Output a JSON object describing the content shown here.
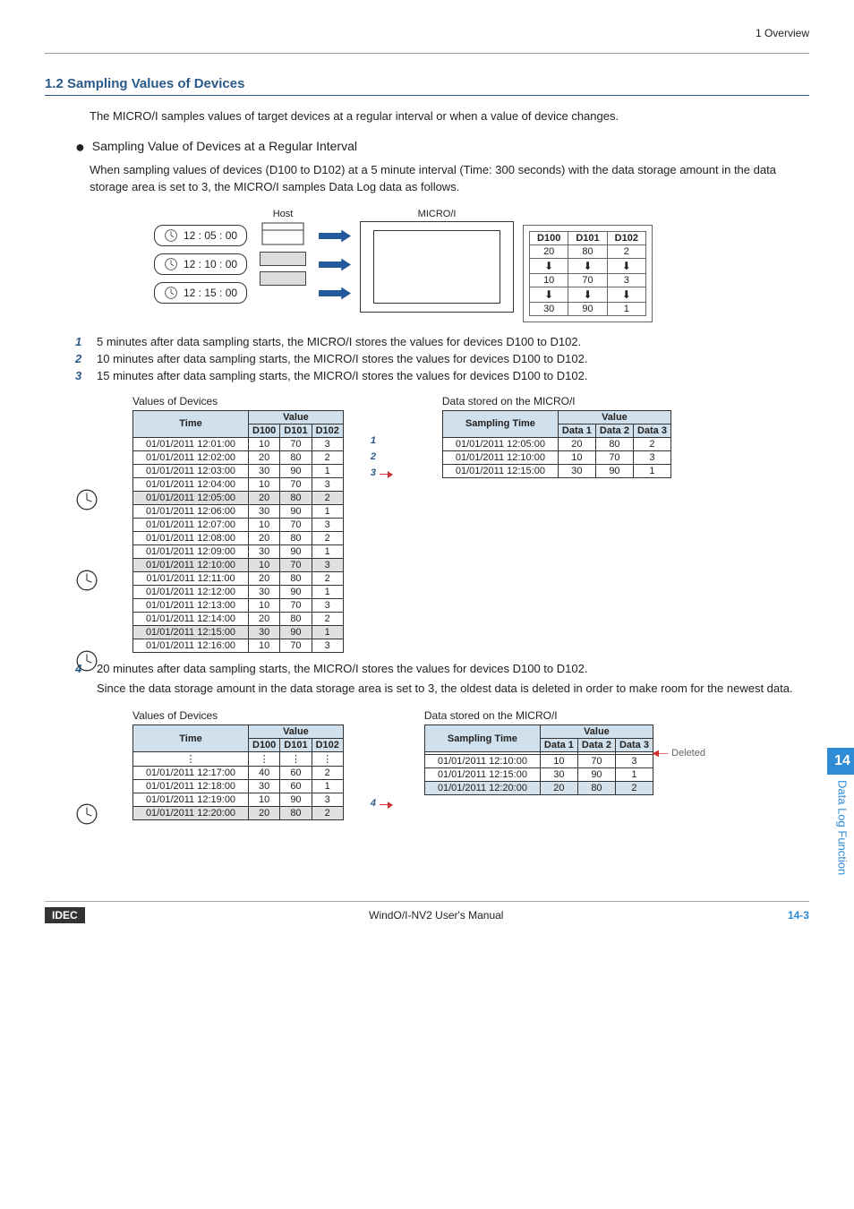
{
  "header": {
    "section": "1 Overview"
  },
  "title": "1.2  Sampling Values of Devices",
  "intro": "The MICRO/I samples values of target devices at a regular interval or when a value of device changes.",
  "sub1": {
    "heading": "Sampling Value of Devices at a Regular Interval",
    "text": "When sampling values of devices (D100 to D102) at a 5 minute interval (Time: 300 seconds) with the data storage amount in the data storage area is set to 3, the MICRO/I samples Data Log data as follows."
  },
  "diagram": {
    "host_label": "Host",
    "microi_label": "MICRO/I",
    "times": [
      "12 : 05 : 00",
      "12 : 10 : 00",
      "12 : 15 : 00"
    ],
    "d_headers": [
      "D100",
      "D101",
      "D102"
    ],
    "d_rows": [
      [
        "20",
        "80",
        "2"
      ],
      [
        "10",
        "70",
        "3"
      ],
      [
        "30",
        "90",
        "1"
      ]
    ]
  },
  "steps123": [
    "5 minutes after data sampling starts, the MICRO/I stores the values for devices D100 to D102.",
    "10 minutes after data sampling starts, the MICRO/I stores the values for devices D100 to D102.",
    "15 minutes after data sampling starts, the MICRO/I stores the values for devices D100 to D102."
  ],
  "table1": {
    "left_caption": "Values of Devices",
    "right_caption": "Data stored on the MICRO/I",
    "left_headers": {
      "time": "Time",
      "value": "Value",
      "cols": [
        "D100",
        "D101",
        "D102"
      ]
    },
    "right_headers": {
      "time": "Sampling Time",
      "value": "Value",
      "cols": [
        "Data 1",
        "Data 2",
        "Data 3"
      ]
    },
    "left_rows": [
      {
        "t": "01/01/2011 12:01:00",
        "v": [
          "10",
          "70",
          "3"
        ]
      },
      {
        "t": "01/01/2011 12:02:00",
        "v": [
          "20",
          "80",
          "2"
        ]
      },
      {
        "t": "01/01/2011 12:03:00",
        "v": [
          "30",
          "90",
          "1"
        ]
      },
      {
        "t": "01/01/2011 12:04:00",
        "v": [
          "10",
          "70",
          "3"
        ]
      },
      {
        "t": "01/01/2011 12:05:00",
        "v": [
          "20",
          "80",
          "2"
        ],
        "hl": true,
        "clock": true
      },
      {
        "t": "01/01/2011 12:06:00",
        "v": [
          "30",
          "90",
          "1"
        ]
      },
      {
        "t": "01/01/2011 12:07:00",
        "v": [
          "10",
          "70",
          "3"
        ]
      },
      {
        "t": "01/01/2011 12:08:00",
        "v": [
          "20",
          "80",
          "2"
        ]
      },
      {
        "t": "01/01/2011 12:09:00",
        "v": [
          "30",
          "90",
          "1"
        ]
      },
      {
        "t": "01/01/2011 12:10:00",
        "v": [
          "10",
          "70",
          "3"
        ],
        "hl": true,
        "clock": true
      },
      {
        "t": "01/01/2011 12:11:00",
        "v": [
          "20",
          "80",
          "2"
        ]
      },
      {
        "t": "01/01/2011 12:12:00",
        "v": [
          "30",
          "90",
          "1"
        ]
      },
      {
        "t": "01/01/2011 12:13:00",
        "v": [
          "10",
          "70",
          "3"
        ]
      },
      {
        "t": "01/01/2011 12:14:00",
        "v": [
          "20",
          "80",
          "2"
        ]
      },
      {
        "t": "01/01/2011 12:15:00",
        "v": [
          "30",
          "90",
          "1"
        ],
        "hl": true,
        "clock": true
      },
      {
        "t": "01/01/2011 12:16:00",
        "v": [
          "10",
          "70",
          "3"
        ]
      }
    ],
    "right_rows": [
      {
        "t": "01/01/2011 12:05:00",
        "v": [
          "20",
          "80",
          "2"
        ]
      },
      {
        "t": "01/01/2011 12:10:00",
        "v": [
          "10",
          "70",
          "3"
        ]
      },
      {
        "t": "01/01/2011 12:15:00",
        "v": [
          "30",
          "90",
          "1"
        ]
      }
    ]
  },
  "step4": {
    "num": "4",
    "line1": "20 minutes after data sampling starts, the MICRO/I stores the values for devices D100 to D102.",
    "line2": "Since the data storage amount in the data storage area is set to 3, the oldest data is deleted in order to make room for the newest data."
  },
  "table2": {
    "left_caption": "Values of Devices",
    "right_caption": "Data stored on the MICRO/I",
    "left_rows": [
      {
        "t": "⋮",
        "v": [
          "⋮",
          "⋮",
          "⋮"
        ]
      },
      {
        "t": "01/01/2011 12:17:00",
        "v": [
          "40",
          "60",
          "2"
        ]
      },
      {
        "t": "01/01/2011 12:18:00",
        "v": [
          "30",
          "60",
          "1"
        ]
      },
      {
        "t": "01/01/2011 12:19:00",
        "v": [
          "10",
          "90",
          "3"
        ]
      },
      {
        "t": "01/01/2011 12:20:00",
        "v": [
          "20",
          "80",
          "2"
        ],
        "hl": true,
        "clock": true
      }
    ],
    "right_rows": [
      {
        "t": "",
        "v": [
          "",
          "",
          ""
        ],
        "deleted": true
      },
      {
        "t": "01/01/2011 12:10:00",
        "v": [
          "10",
          "70",
          "3"
        ]
      },
      {
        "t": "01/01/2011 12:15:00",
        "v": [
          "30",
          "90",
          "1"
        ]
      },
      {
        "t": "01/01/2011 12:20:00",
        "v": [
          "20",
          "80",
          "2"
        ],
        "hl": true
      }
    ],
    "deleted_label": "Deleted"
  },
  "tab": {
    "num": "14",
    "text": "Data Log Function"
  },
  "footer": {
    "logo": "IDEC",
    "center": "WindO/I-NV2 User's Manual",
    "page": "14-3"
  }
}
